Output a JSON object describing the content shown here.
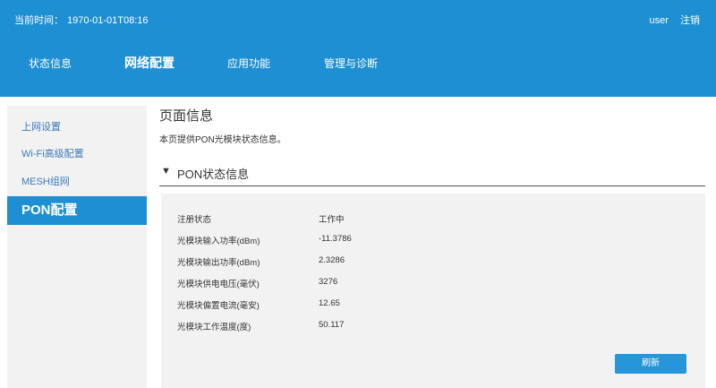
{
  "header": {
    "time_label": "当前时间：",
    "time_value": "1970-01-01T08:16",
    "user": "user",
    "logout": "注销"
  },
  "nav": {
    "items": [
      {
        "label": "状态信息"
      },
      {
        "label": "网络配置"
      },
      {
        "label": "应用功能"
      },
      {
        "label": "管理与诊断"
      }
    ],
    "active": "网络配置"
  },
  "sidebar": {
    "items": [
      {
        "label": "上网设置"
      },
      {
        "label": "Wi-Fi高级配置"
      },
      {
        "label": "MESH组网"
      },
      {
        "label": "PON配置"
      }
    ],
    "active": "PON配置"
  },
  "page": {
    "title": "页面信息",
    "description": "本页提供PON光模块状态信息。"
  },
  "section": {
    "arrow": "▼",
    "title": "PON状态信息"
  },
  "status_rows": [
    {
      "label": "注册状态",
      "value": "工作中"
    },
    {
      "label": "光模块输入功率(dBm)",
      "value": "-11.3786"
    },
    {
      "label": "光模块输出功率(dBm)",
      "value": "2.3286"
    },
    {
      "label": "光模块供电电压(毫伏)",
      "value": "3276"
    },
    {
      "label": "光模块偏置电流(毫安)",
      "value": "12.65"
    },
    {
      "label": "光模块工作温度(度)",
      "value": "50.117"
    }
  ],
  "buttons": {
    "refresh": "刷新"
  },
  "colors": {
    "brand": "#1e8fd3",
    "sidebar_bg": "#f2f2f2",
    "link": "#3d7ab8"
  }
}
